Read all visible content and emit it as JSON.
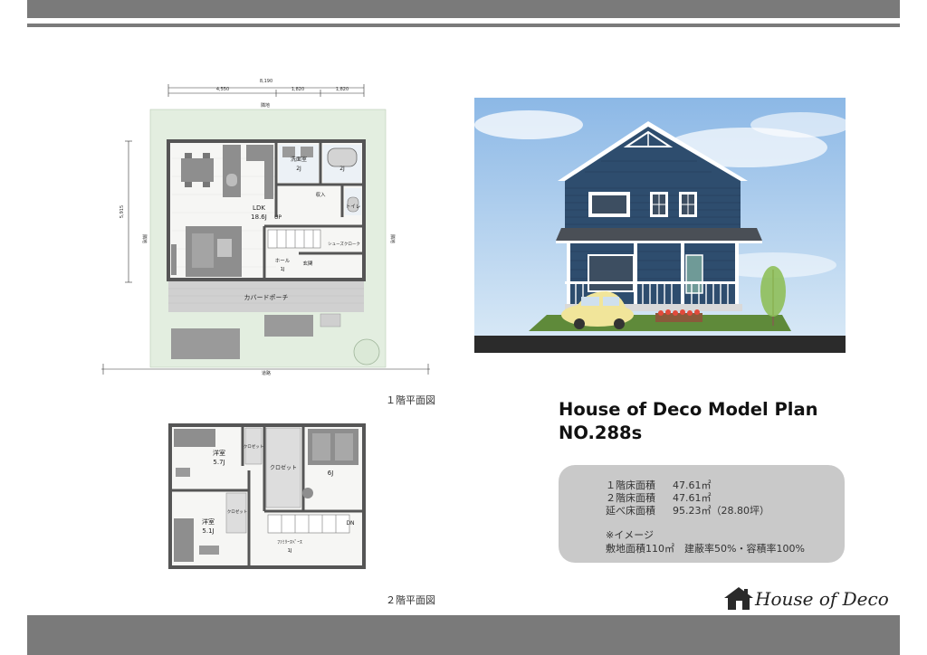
{
  "title": {
    "line1": "House of Deco Model Plan",
    "line2": "NO.288s"
  },
  "floor1": {
    "caption": "１階平面図",
    "dims": {
      "total": "8,190",
      "d1": "4,550",
      "d2": "1,820",
      "d3": "1,820",
      "depth": "5,915"
    },
    "labels": {
      "neighbor_top": "隣地",
      "neighbor_left": "隣地",
      "neighbor_right": "隣地",
      "road": "道路",
      "ldk": "LDK",
      "ldk_size": "18.6J",
      "up": "UP",
      "washroom": "洗面室",
      "washroom_size": "2J",
      "bath_size": "2J",
      "storage": "収入",
      "toilet": "トイレ",
      "shoes_cloak": "シューズクローク",
      "hall": "ホール",
      "hall_size": "1J",
      "entrance": "玄関",
      "porch": "カバードポーチ"
    }
  },
  "floor2": {
    "caption": "２階平面図",
    "labels": {
      "western_room_a": "洋室",
      "western_room_a_size": "5.7J",
      "closet_a": "クロゼット",
      "closet_b": "クロゼット",
      "room_6j": "6J",
      "western_room_b": "洋室",
      "western_room_b_size": "5.1J",
      "closet_c": "クロゼット",
      "down": "DN",
      "family_space": "ﾌｧﾐﾘｰｽﾍﾟｰｽ",
      "family_space_size": "1J"
    }
  },
  "specs": {
    "rows": [
      {
        "label": "１階床面積",
        "value": "47.61㎡"
      },
      {
        "label": "２階床面積",
        "value": "47.61㎡"
      },
      {
        "label": "延べ床面積",
        "value": "95.23㎡（28.80坪）"
      }
    ],
    "note_title": "※イメージ",
    "note_line": "敷地面積110㎡　建蔽率50%・容積率100%"
  },
  "logo": {
    "text": "House of Deco"
  },
  "colors": {
    "bars": "#7a7a7a",
    "spec_box": "#c9c9c9",
    "lawn": "#e3eee0",
    "siding": "#2e4d6e",
    "sky": "#9ec3ea"
  }
}
